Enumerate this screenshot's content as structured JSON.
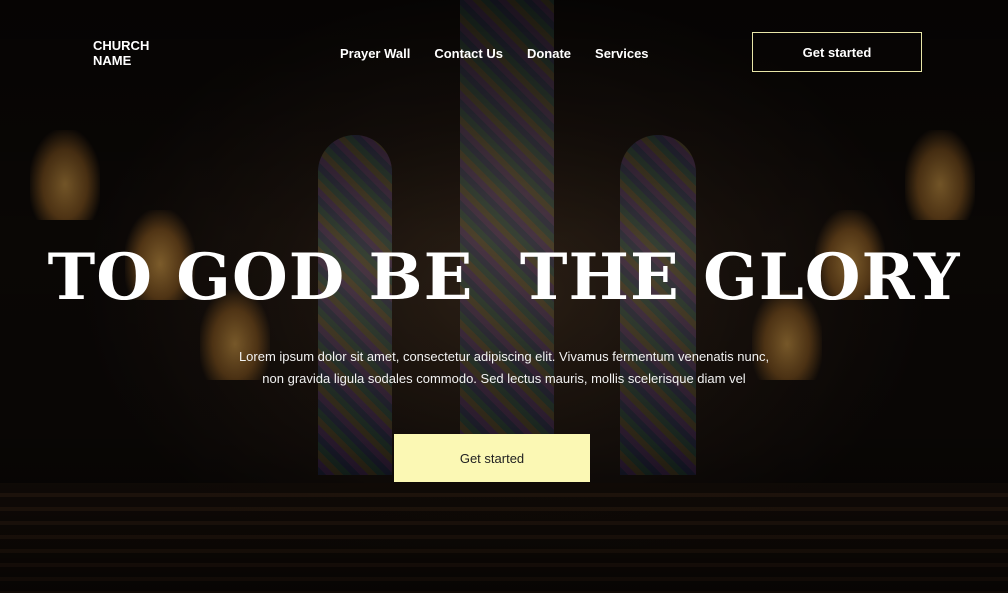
{
  "brand": {
    "name": "CHURCH NAME"
  },
  "nav": {
    "items": [
      "Prayer Wall",
      "Contact Us",
      "Donate",
      "Services"
    ]
  },
  "header": {
    "cta_label": "Get started"
  },
  "hero": {
    "title": "TO GOD BE  THE GLORY",
    "description": "Lorem ipsum dolor sit amet, consectetur adipiscing elit. Vivamus fermentum venenatis nunc, non gravida ligula sodales commodo. Sed lectus mauris, mollis scelerisque diam vel",
    "cta_label": "Get started"
  },
  "colors": {
    "accent_button": "#fbf8b4",
    "outline_border": "#e8e6a8"
  }
}
